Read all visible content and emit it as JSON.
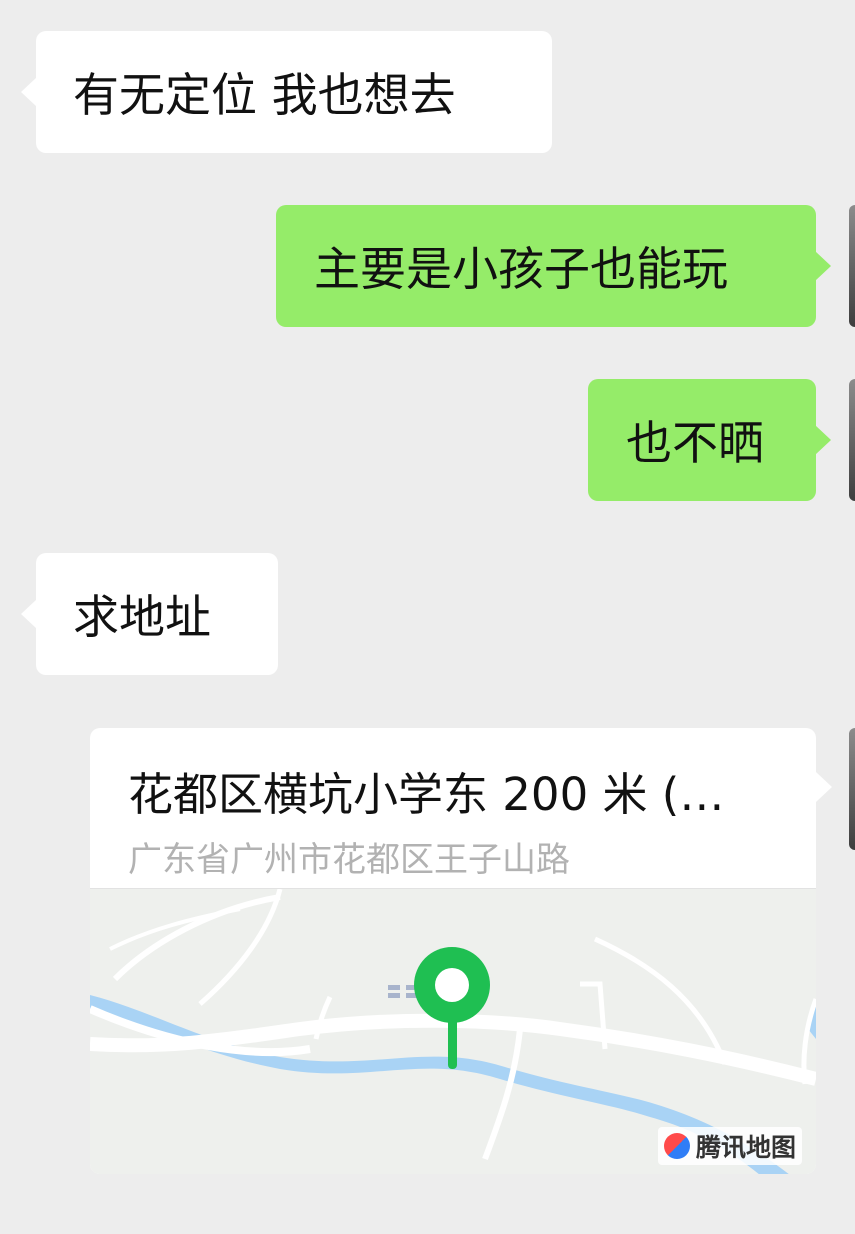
{
  "messages": [
    {
      "side": "left",
      "text": "有无定位 我也想去"
    },
    {
      "side": "right",
      "text": "主要是小孩子也能玩"
    },
    {
      "side": "right",
      "text": "也不晒"
    },
    {
      "side": "left",
      "text": "求地址"
    }
  ],
  "location": {
    "title": "花都区横坑小学东 200 米 (…",
    "address": "广东省广州市花都区王子山路",
    "map_provider": "腾讯地图",
    "pin_color": "#1fbf52",
    "river_color": "#a9d3f5",
    "road_color": "#ffffff"
  },
  "colors": {
    "background": "#ededed",
    "outgoing_bubble": "#95ec69",
    "incoming_bubble": "#ffffff"
  },
  "icons": {
    "map_pin": "location-pin-icon",
    "map_logo": "tencent-map-logo-icon"
  }
}
